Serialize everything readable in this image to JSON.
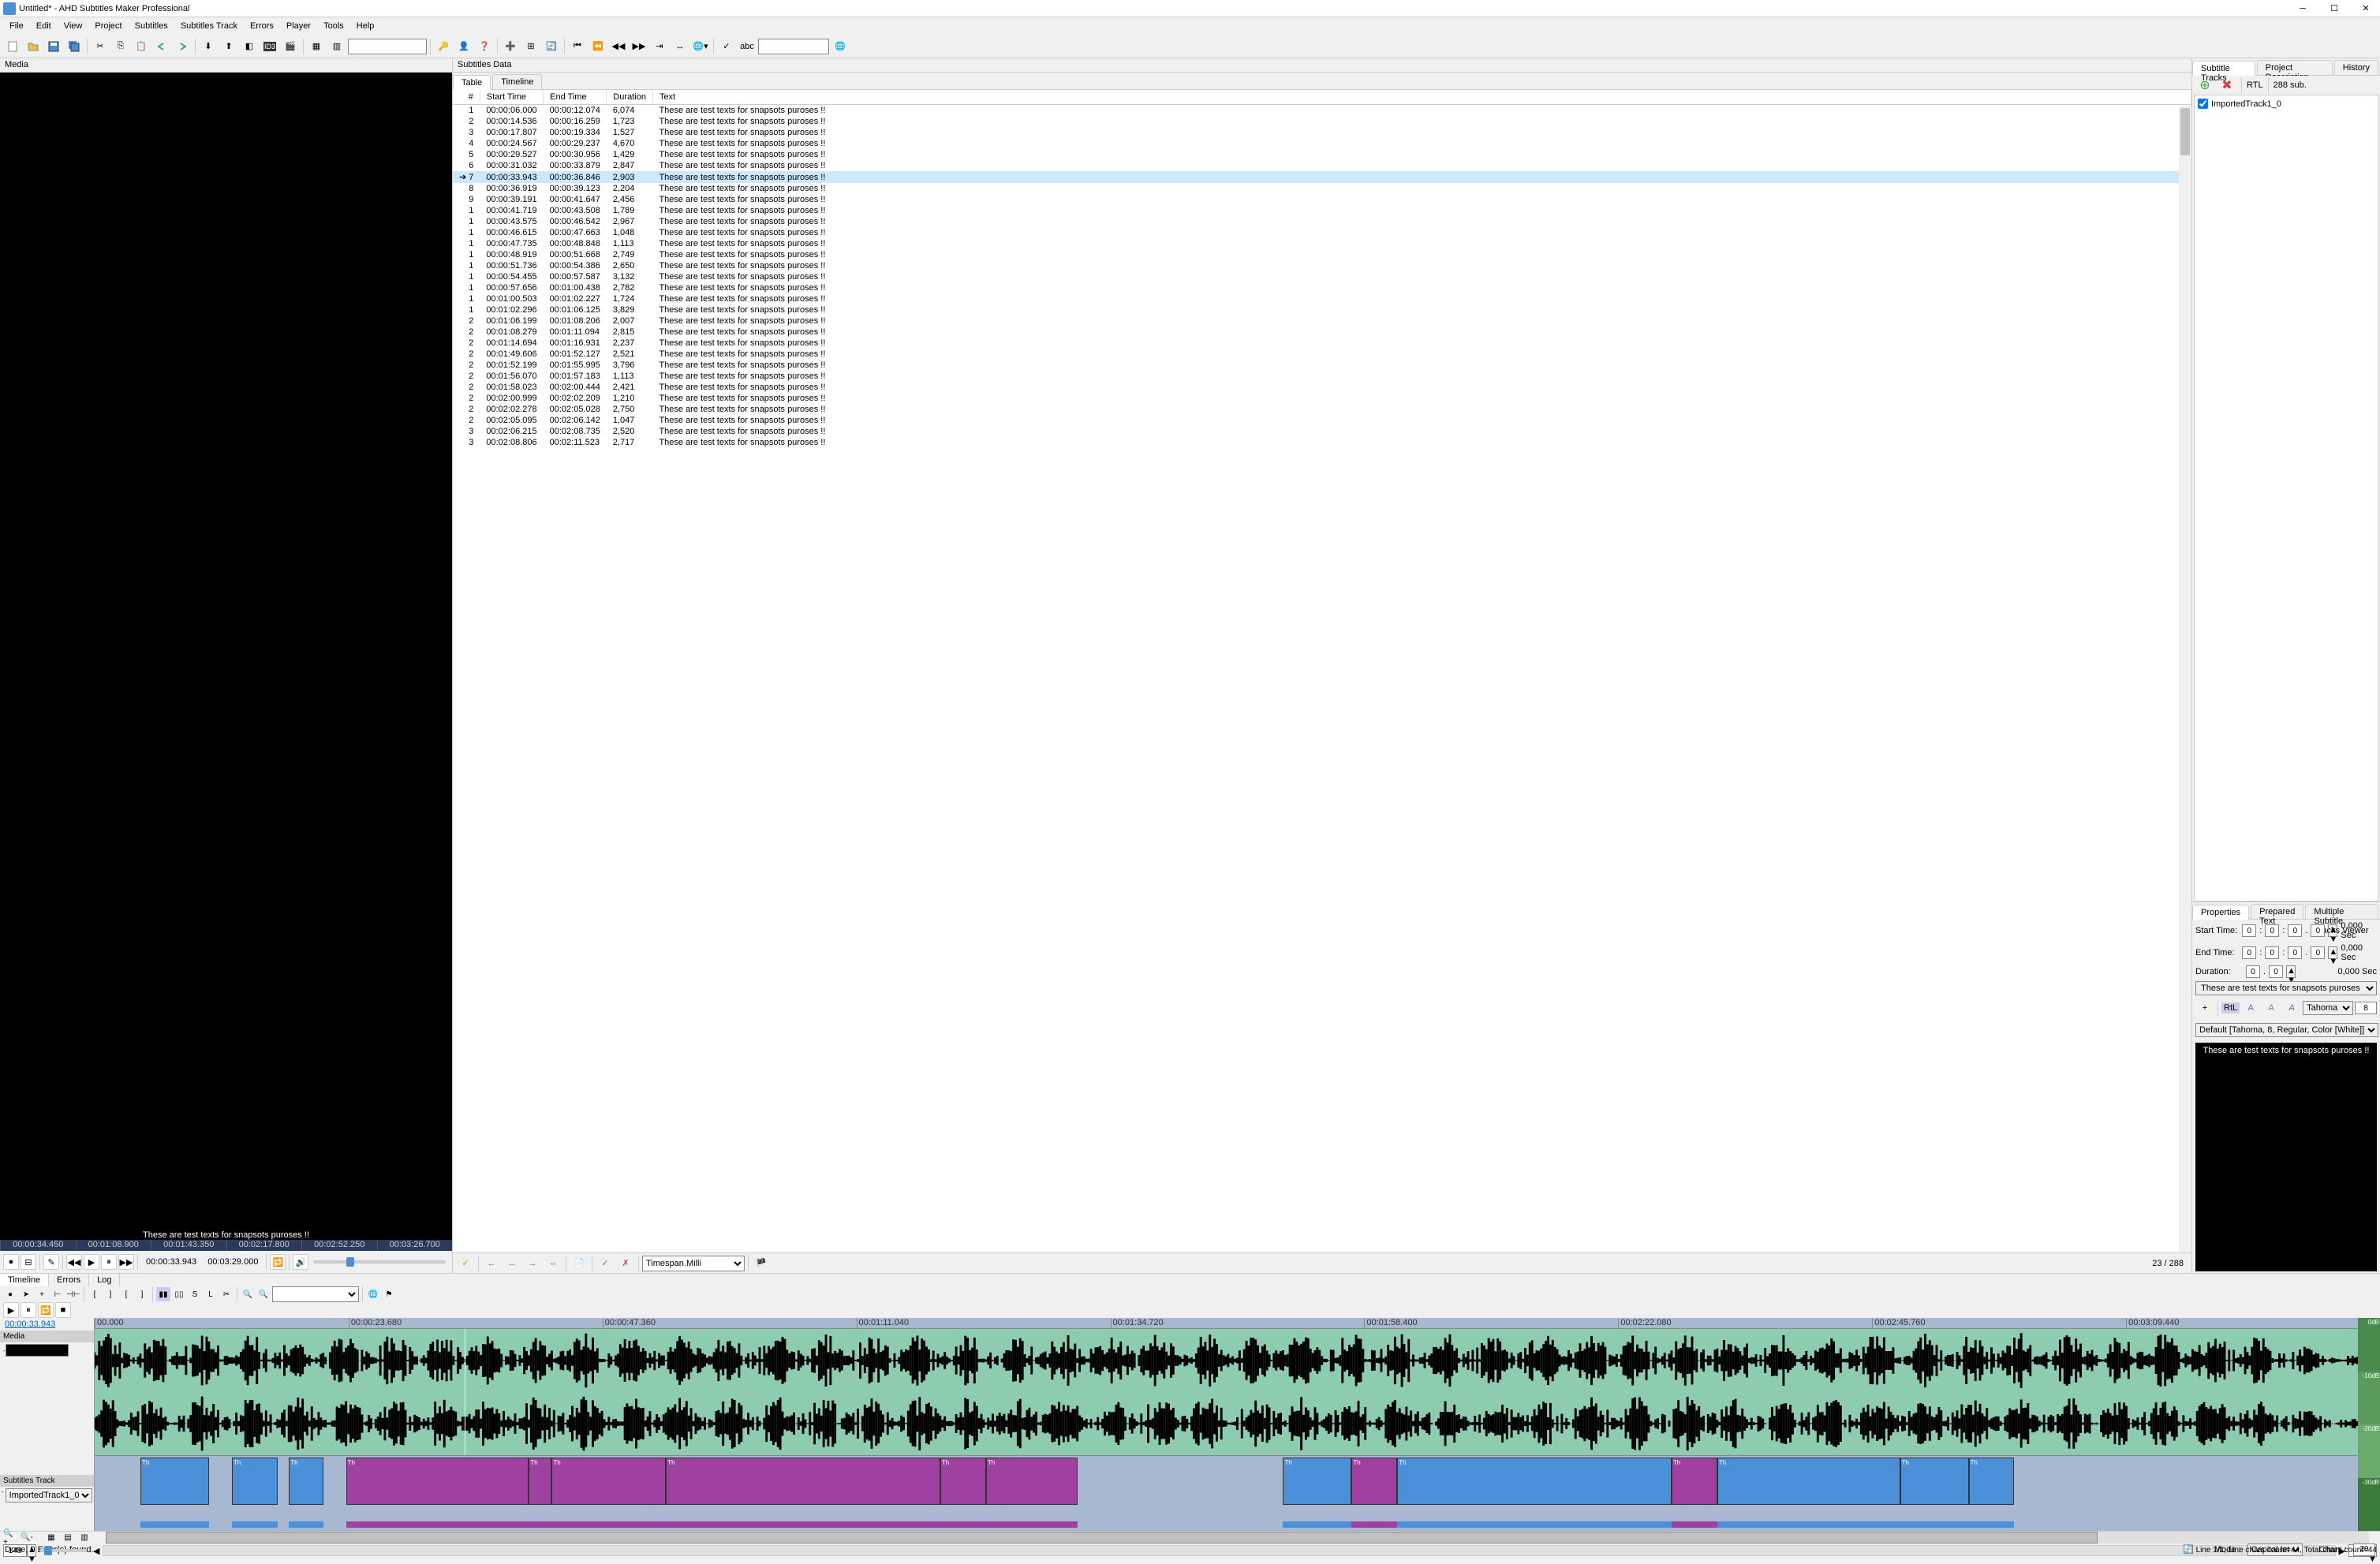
{
  "title": "Untitled* - AHD Subtitles Maker Professional",
  "menus": [
    "File",
    "Edit",
    "View",
    "Project",
    "Subtitles",
    "Subtitles Track",
    "Errors",
    "Player",
    "Tools",
    "Help"
  ],
  "media_label": "Media",
  "video_subtitle": "These are test texts for snapsots puroses !!",
  "video_ruler": [
    "00:00:34.450",
    "00:01:08.900",
    "00:01:43.350",
    "00:02:17.800",
    "00:02:52.250",
    "00:03:26.700"
  ],
  "video_time_current": "00:00:33.943",
  "video_time_total": "00:03:29.000",
  "subtitles_data_label": "Subtitles Data",
  "tabs": {
    "table": "Table",
    "timeline": "Timeline"
  },
  "table_headers": {
    "num": "#",
    "start": "Start Time",
    "end": "End Time",
    "duration": "Duration",
    "text": "Text"
  },
  "subtitle_rows": [
    {
      "n": "1",
      "s": "00:00:06.000",
      "e": "00:00:12.074",
      "d": "6,074",
      "t": "These are test texts for snapsots puroses !!"
    },
    {
      "n": "2",
      "s": "00:00:14.536",
      "e": "00:00:16.259",
      "d": "1,723",
      "t": "These are test texts for snapsots puroses !!"
    },
    {
      "n": "3",
      "s": "00:00:17.807",
      "e": "00:00:19.334",
      "d": "1,527",
      "t": "These are test texts for snapsots puroses !!"
    },
    {
      "n": "4",
      "s": "00:00:24.567",
      "e": "00:00:29.237",
      "d": "4,670",
      "t": "These are test texts for snapsots puroses !!"
    },
    {
      "n": "5",
      "s": "00:00:29.527",
      "e": "00:00:30.956",
      "d": "1,429",
      "t": "These are test texts for snapsots puroses !!"
    },
    {
      "n": "6",
      "s": "00:00:31.032",
      "e": "00:00:33.879",
      "d": "2,847",
      "t": "These are test texts for snapsots puroses !!"
    },
    {
      "n": "7",
      "s": "00:00:33.943",
      "e": "00:00:36.846",
      "d": "2,903",
      "t": "These are test texts for snapsots puroses !!",
      "sel": true
    },
    {
      "n": "8",
      "s": "00:00:36.919",
      "e": "00:00:39.123",
      "d": "2,204",
      "t": "These are test texts for snapsots puroses !!"
    },
    {
      "n": "9",
      "s": "00:00:39.191",
      "e": "00:00:41.647",
      "d": "2,456",
      "t": "These are test texts for snapsots puroses !!"
    },
    {
      "n": "1",
      "s": "00:00:41.719",
      "e": "00:00:43.508",
      "d": "1,789",
      "t": "These are test texts for snapsots puroses !!"
    },
    {
      "n": "1",
      "s": "00:00:43.575",
      "e": "00:00:46.542",
      "d": "2,967",
      "t": "These are test texts for snapsots puroses !!"
    },
    {
      "n": "1",
      "s": "00:00:46.615",
      "e": "00:00:47.663",
      "d": "1,048",
      "t": "These are test texts for snapsots puroses !!"
    },
    {
      "n": "1",
      "s": "00:00:47.735",
      "e": "00:00:48.848",
      "d": "1,113",
      "t": "These are test texts for snapsots puroses !!"
    },
    {
      "n": "1",
      "s": "00:00:48.919",
      "e": "00:00:51.668",
      "d": "2,749",
      "t": "These are test texts for snapsots puroses !!"
    },
    {
      "n": "1",
      "s": "00:00:51.736",
      "e": "00:00:54.386",
      "d": "2,650",
      "t": "These are test texts for snapsots puroses !!"
    },
    {
      "n": "1",
      "s": "00:00:54.455",
      "e": "00:00:57.587",
      "d": "3,132",
      "t": "These are test texts for snapsots puroses !!"
    },
    {
      "n": "1",
      "s": "00:00:57.656",
      "e": "00:01:00.438",
      "d": "2,782",
      "t": "These are test texts for snapsots puroses !!"
    },
    {
      "n": "1",
      "s": "00:01:00.503",
      "e": "00:01:02.227",
      "d": "1,724",
      "t": "These are test texts for snapsots puroses !!"
    },
    {
      "n": "1",
      "s": "00:01:02.296",
      "e": "00:01:06.125",
      "d": "3,829",
      "t": "These are test texts for snapsots puroses !!"
    },
    {
      "n": "2",
      "s": "00:01:06.199",
      "e": "00:01:08.206",
      "d": "2,007",
      "t": "These are test texts for snapsots puroses !!"
    },
    {
      "n": "2",
      "s": "00:01:08.279",
      "e": "00:01:11.094",
      "d": "2,815",
      "t": "These are test texts for snapsots puroses !!"
    },
    {
      "n": "2",
      "s": "00:01:14.694",
      "e": "00:01:16.931",
      "d": "2,237",
      "t": "These are test texts for snapsots puroses !!"
    },
    {
      "n": "2",
      "s": "00:01:49.606",
      "e": "00:01:52.127",
      "d": "2,521",
      "t": "These are test texts for snapsots puroses !!"
    },
    {
      "n": "2",
      "s": "00:01:52.199",
      "e": "00:01:55.995",
      "d": "3,796",
      "t": "These are test texts for snapsots puroses !!"
    },
    {
      "n": "2",
      "s": "00:01:56.070",
      "e": "00:01:57.183",
      "d": "1,113",
      "t": "These are test texts for snapsots puroses !!"
    },
    {
      "n": "2",
      "s": "00:01:58.023",
      "e": "00:02:00.444",
      "d": "2,421",
      "t": "These are test texts for snapsots puroses !!"
    },
    {
      "n": "2",
      "s": "00:02:00.999",
      "e": "00:02:02.209",
      "d": "1,210",
      "t": "These are test texts for snapsots puroses !!"
    },
    {
      "n": "2",
      "s": "00:02:02.278",
      "e": "00:02:05.028",
      "d": "2,750",
      "t": "These are test texts for snapsots puroses !!"
    },
    {
      "n": "2",
      "s": "00:02:05.095",
      "e": "00:02:06.142",
      "d": "1,047",
      "t": "These are test texts for snapsots puroses !!"
    },
    {
      "n": "3",
      "s": "00:02:06.215",
      "e": "00:02:08.735",
      "d": "2,520",
      "t": "These are test texts for snapsots puroses !!"
    },
    {
      "n": "3",
      "s": "00:02:08.806",
      "e": "00:02:11.523",
      "d": "2,717",
      "t": "These are test texts for snapsots puroses !!"
    }
  ],
  "time_format": "Timespan.Milli",
  "row_count": "23 / 288",
  "right_tabs": {
    "tracks": "Subtitle Tracks",
    "desc": "Project Description",
    "history": "History"
  },
  "rtl_label": "RTL",
  "sub_count": "288 sub.",
  "track_name": "ImportedTrack1_0",
  "props_tabs": {
    "props": "Properties",
    "prepared": "Prepared Text",
    "multi": "Multiple Subtitle Tracks Viewer"
  },
  "props": {
    "start_label": "Start Time:",
    "start_sec": "0,000 Sec",
    "end_label": "End Time:",
    "end_sec": "0,000 Sec",
    "dur_label": "Duration:",
    "dur_sec": "0,000 Sec"
  },
  "preview_text": "These are test texts for snapsots puroses !!",
  "font_rtl": "RtL",
  "font_name": "Tahoma",
  "font_size": "8",
  "font_default": "Default [Tahoma, 8, Regular, Color [White]]",
  "bottom_tabs": {
    "timeline": "Timeline",
    "errors": "Errors",
    "log": "Log"
  },
  "tl_time": "00:00:33.943",
  "tl_media": "Media",
  "tl_subtrack": "Subtitles Track",
  "tl_track_sel": "ImportedTrack1_0",
  "tl_ruler": [
    "00.000",
    "00:00:23.680",
    "00:00:47.360",
    "00:01:11.040",
    "00:01:34.720",
    "00:01:58.400",
    "00:02:22.080",
    "00:02:45.760",
    "00:03:09.440"
  ],
  "tl_zoom_val": "148",
  "tl_zoom_right": "40",
  "status_text": "Done, 0 Error(s) found.",
  "status_mode_label": "Mode :",
  "status_mode": "Capital letter",
  "status_chars_label": "Chars :",
  "status_chars": "20",
  "status_line": "Line 1/1, Line chars count=44, Total chars count=44",
  "db_labels": [
    "0dB",
    "-10dB",
    "-20dB",
    "-30dB"
  ]
}
